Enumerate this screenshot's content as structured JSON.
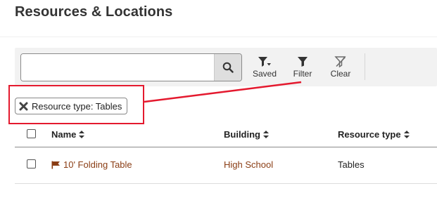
{
  "page": {
    "title": "Resources & Locations"
  },
  "toolbar": {
    "search": {
      "value": "",
      "placeholder": ""
    },
    "saved_label": "Saved",
    "filter_label": "Filter",
    "clear_label": "Clear"
  },
  "active_filter": {
    "label": "Resource type: Tables"
  },
  "table": {
    "headers": {
      "name": "Name",
      "building": "Building",
      "type": "Resource type"
    },
    "rows": [
      {
        "name": "10' Folding Table",
        "building": "High School",
        "type": "Tables"
      }
    ]
  },
  "colors": {
    "callout": "#e4192e",
    "link": "#8a3d14"
  },
  "icons": [
    "search-icon",
    "saved-filter-icon",
    "filter-icon",
    "clear-filter-icon",
    "close-icon",
    "sort-icon",
    "flag-icon"
  ]
}
